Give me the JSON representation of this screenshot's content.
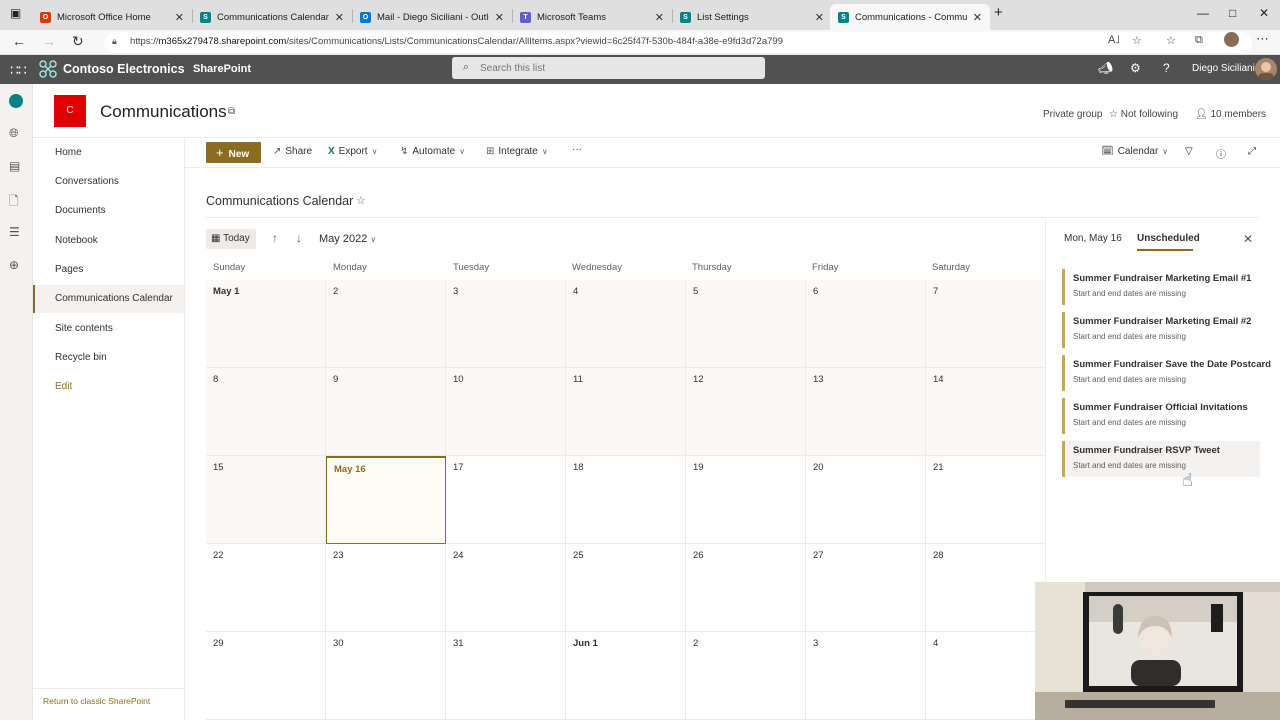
{
  "browser": {
    "tabs": [
      {
        "label": "Microsoft Office Home",
        "favicon_color": "#d83b01",
        "favicon_glyph": "O"
      },
      {
        "label": "Communications Calendar - Sum",
        "favicon_color": "#038387",
        "favicon_glyph": "S"
      },
      {
        "label": "Mail - Diego Siciliani - Outlook",
        "favicon_color": "#0078d4",
        "favicon_glyph": "O"
      },
      {
        "label": "Microsoft Teams",
        "favicon_color": "#5b5fc7",
        "favicon_glyph": "T"
      },
      {
        "label": "List Settings",
        "favicon_color": "#038387",
        "favicon_glyph": "S"
      },
      {
        "label": "Communications - Communicatio",
        "favicon_color": "#038387",
        "favicon_glyph": "S"
      }
    ],
    "url_prefix": "https://",
    "url_host": "m365x279478.sharepoint.com",
    "url_path": "/sites/Communications/Lists/CommunicationsCalendar/AllItems.aspx?viewid=6c25f47f-530b-484f-a38e-e9fd3d72a799"
  },
  "suite": {
    "brand": "Contoso Electronics",
    "app": "SharePoint",
    "search_placeholder": "Search this list",
    "user": "Diego Siciliani"
  },
  "site": {
    "logo_letter": "C",
    "title": "Communications",
    "privacy": "Private group",
    "follow": "Not following",
    "members": "10 members"
  },
  "nav": {
    "items": [
      "Home",
      "Conversations",
      "Documents",
      "Notebook",
      "Pages",
      "Communications Calendar",
      "Site contents",
      "Recycle bin"
    ],
    "edit": "Edit",
    "classic": "Return to classic SharePoint"
  },
  "commands": {
    "new": "New",
    "share": "Share",
    "export": "Export",
    "automate": "Automate",
    "integrate": "Integrate",
    "more": "···",
    "view": "Calendar"
  },
  "list": {
    "title": "Communications Calendar"
  },
  "calendar": {
    "today_label": "Today",
    "month": "May 2022",
    "days": [
      "Sunday",
      "Monday",
      "Tuesday",
      "Wednesday",
      "Thursday",
      "Friday",
      "Saturday"
    ],
    "weeks": [
      [
        "May 1",
        "2",
        "3",
        "4",
        "5",
        "6",
        "7"
      ],
      [
        "8",
        "9",
        "10",
        "11",
        "12",
        "13",
        "14"
      ],
      [
        "15",
        "May 16",
        "17",
        "18",
        "19",
        "20",
        "21"
      ],
      [
        "22",
        "23",
        "24",
        "25",
        "26",
        "27",
        "28"
      ],
      [
        "29",
        "30",
        "31",
        "Jun 1",
        "2",
        "3",
        "4"
      ]
    ]
  },
  "panel": {
    "tab_date": "Mon, May 16",
    "tab_unscheduled": "Unscheduled",
    "items": [
      {
        "title": "Summer Fundraiser Marketing Email #1",
        "subtitle": "Start and end dates are missing"
      },
      {
        "title": "Summer Fundraiser Marketing Email #2",
        "subtitle": "Start and end dates are missing"
      },
      {
        "title": "Summer Fundraiser Save the Date Postcard",
        "subtitle": "Start and end dates are missing"
      },
      {
        "title": "Summer Fundraiser Official Invitations",
        "subtitle": "Start and end dates are missing"
      },
      {
        "title": "Summer Fundraiser RSVP Tweet",
        "subtitle": "Start and end dates are missing"
      }
    ]
  },
  "colors": {
    "accent": "#8c6d1f",
    "suitebar": "#515151",
    "site_logo": "#e00000",
    "item_bar": "#c9a64f"
  }
}
